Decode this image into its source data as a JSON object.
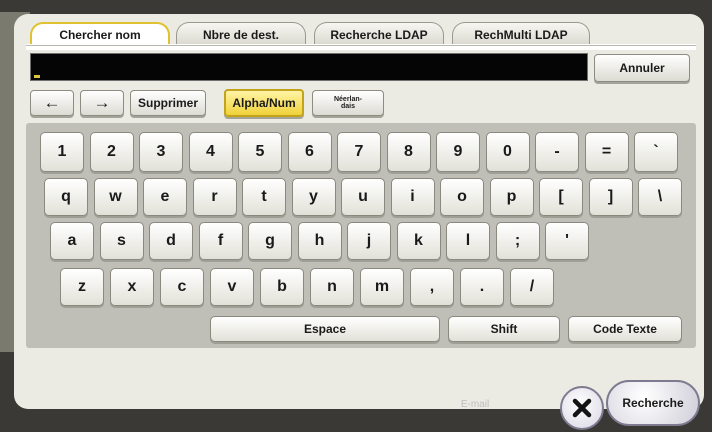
{
  "tabs": [
    {
      "label": "Chercher nom",
      "active": true
    },
    {
      "label": "Nbre de dest.",
      "active": false
    },
    {
      "label": "Recherche LDAP",
      "active": false
    },
    {
      "label": "RechMulti LDAP",
      "active": false
    }
  ],
  "input": {
    "value": ""
  },
  "buttons": {
    "cancel": "Annuler",
    "left_arrow": "←",
    "right_arrow": "→",
    "delete": "Supprimer",
    "alphanum": "Alpha/Num",
    "dutch": "Néerlan-\ndais"
  },
  "keyboard": {
    "row1": [
      "1",
      "2",
      "3",
      "4",
      "5",
      "6",
      "7",
      "8",
      "9",
      "0",
      "-",
      "=",
      "`"
    ],
    "row2": [
      "q",
      "w",
      "e",
      "r",
      "t",
      "y",
      "u",
      "i",
      "o",
      "p",
      "[",
      "]",
      "\\"
    ],
    "row3": [
      "a",
      "s",
      "d",
      "f",
      "g",
      "h",
      "j",
      "k",
      "l",
      ";",
      "'"
    ],
    "row4": [
      "z",
      "x",
      "c",
      "v",
      "b",
      "n",
      "m",
      ",",
      ".",
      "/"
    ],
    "space": "Espace",
    "shift": "Shift",
    "code": "Code Texte"
  },
  "footer": {
    "close_icon": "close-x-icon",
    "search": "Recherche",
    "background_text": "E-mail"
  },
  "colors": {
    "active_tab_border": "#e0c230",
    "alphanum_bg": "#f0d23a",
    "input_bg": "#050505"
  }
}
